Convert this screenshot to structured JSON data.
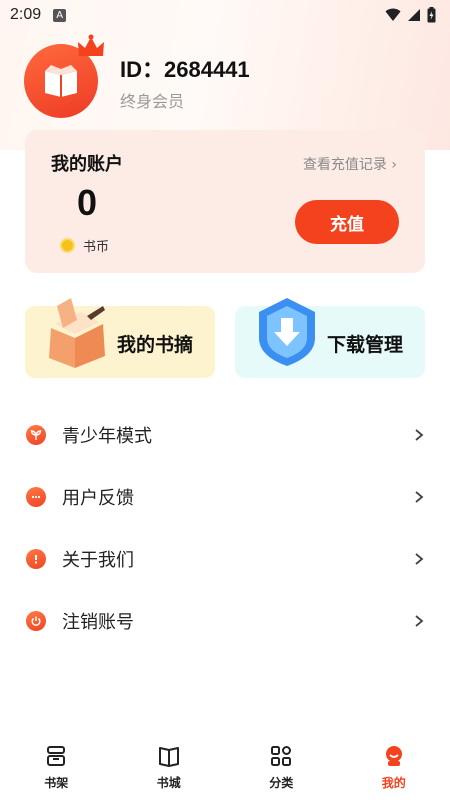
{
  "status_bar": {
    "time": "2:09",
    "notif_letter": "A"
  },
  "profile": {
    "id_text": "ID：2684441",
    "membership": "终身会员"
  },
  "account": {
    "title": "我的账户",
    "record_link": "查看充值记录 ›",
    "balance": "0",
    "currency_label": "书币",
    "recharge_label": "充值"
  },
  "features": {
    "notes_label": "我的书摘",
    "download_label": "下载管理"
  },
  "menu": {
    "items": [
      {
        "label": "青少年模式",
        "icon": "sprout-icon"
      },
      {
        "label": "用户反馈",
        "icon": "chat-icon"
      },
      {
        "label": "关于我们",
        "icon": "info-icon"
      },
      {
        "label": "注销账号",
        "icon": "power-icon"
      }
    ]
  },
  "tabs": [
    {
      "label": "书架",
      "icon": "bookshelf-icon"
    },
    {
      "label": "书城",
      "icon": "bookstore-icon"
    },
    {
      "label": "分类",
      "icon": "category-icon"
    },
    {
      "label": "我的",
      "icon": "profile-icon"
    }
  ],
  "colors": {
    "accent": "#f4421e",
    "card_bg": "#fdece6",
    "notes_bg": "#fdf3cf",
    "download_bg": "#e7fafa"
  }
}
